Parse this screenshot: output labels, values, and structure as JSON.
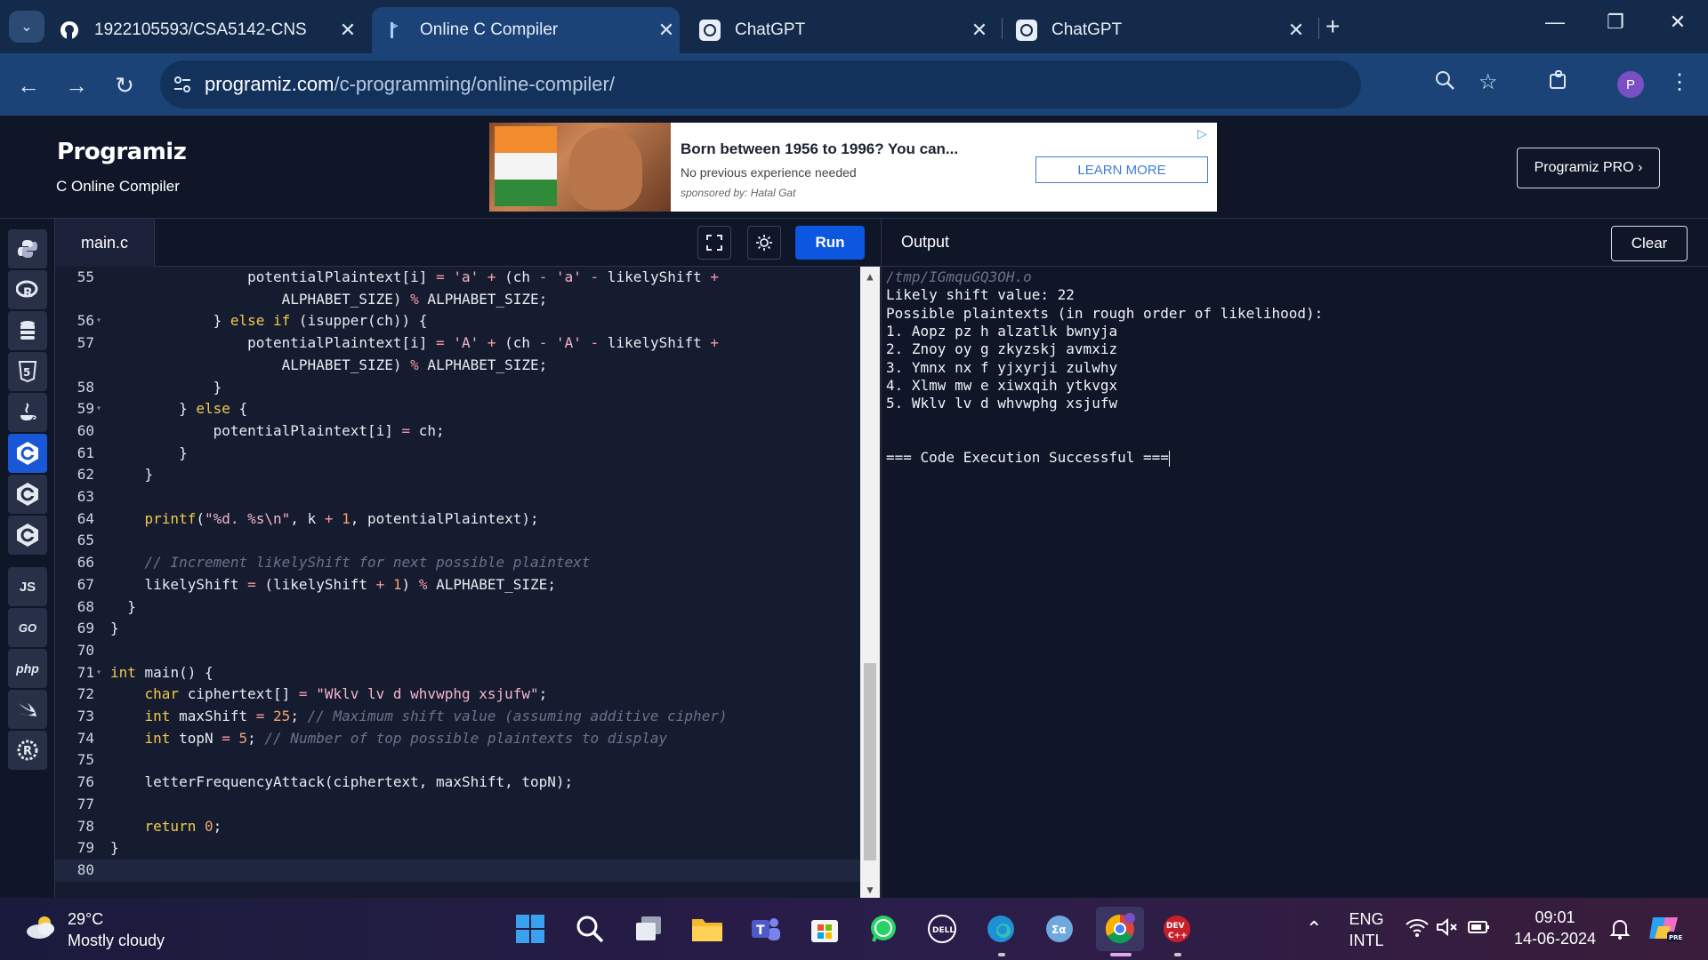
{
  "browser": {
    "tabs": [
      {
        "title": "1922105593/CSA5142-CNS",
        "icon": "github-icon",
        "active": false
      },
      {
        "title": "Online C Compiler",
        "icon": "programiz-icon",
        "active": true
      },
      {
        "title": "ChatGPT",
        "icon": "chatgpt-icon",
        "active": false
      },
      {
        "title": "ChatGPT",
        "icon": "chatgpt-icon",
        "active": false
      }
    ],
    "new_tab": "+",
    "address": {
      "host": "programiz.com",
      "path": "/c-programming/online-compiler/"
    },
    "profile_initial": "P"
  },
  "header": {
    "logo": "Programiz",
    "subtitle": "C Online Compiler",
    "pro_button": "Programiz PRO ›"
  },
  "ad": {
    "title": "Born between 1956 to 1996? You can...",
    "text": "No previous experience needed",
    "sponsor": "sponsored by: Hatal Gat",
    "button": "LEARN MORE"
  },
  "languages": [
    {
      "name": "python-icon",
      "label": "🐍",
      "active": false
    },
    {
      "name": "r-icon",
      "label": "R",
      "active": false
    },
    {
      "name": "sql-icon",
      "label": "≡",
      "active": false
    },
    {
      "name": "html-icon",
      "label": "5",
      "active": false
    },
    {
      "name": "java-icon",
      "label": "♨",
      "active": false
    },
    {
      "name": "c-icon",
      "label": "C",
      "active": true
    },
    {
      "name": "cpp-icon",
      "label": "C",
      "active": false
    },
    {
      "name": "csharp-icon",
      "label": "C",
      "active": false
    },
    {
      "name": "javascript-icon",
      "label": "JS",
      "active": false
    },
    {
      "name": "go-icon",
      "label": "GO",
      "active": false
    },
    {
      "name": "php-icon",
      "label": "php",
      "active": false
    },
    {
      "name": "swift-icon",
      "label": "➶",
      "active": false
    },
    {
      "name": "rust-icon",
      "label": "R",
      "active": false
    }
  ],
  "editor": {
    "file_name": "main.c",
    "run_label": "Run",
    "lines": [
      {
        "n": "55",
        "fold": "",
        "html": "                <span>potentialPlaintext[i]</span> <span class=\"op\">=</span> <span class=\"str\">'a'</span> <span class=\"op\">+</span> (ch <span class=\"op\">-</span> <span class=\"str\">'a'</span> <span class=\"op\">-</span> likelyShift <span class=\"op\">+</span>"
      },
      {
        "n": "",
        "fold": "",
        "html": "                    ALPHABET_SIZE) <span class=\"op\">%</span> ALPHABET_SIZE;"
      },
      {
        "n": "56",
        "fold": "▾",
        "html": "            } <span class=\"kw\">else if</span> (isupper(ch)) {"
      },
      {
        "n": "57",
        "fold": "",
        "html": "                potentialPlaintext[i] <span class=\"op\">=</span> <span class=\"str\">'A'</span> <span class=\"op\">+</span> (ch <span class=\"op\">-</span> <span class=\"str\">'A'</span> <span class=\"op\">-</span> likelyShift <span class=\"op\">+</span>"
      },
      {
        "n": "",
        "fold": "",
        "html": "                    ALPHABET_SIZE) <span class=\"op\">%</span> ALPHABET_SIZE;"
      },
      {
        "n": "58",
        "fold": "",
        "html": "            }"
      },
      {
        "n": "59",
        "fold": "▾",
        "html": "        } <span class=\"kw\">else</span> {"
      },
      {
        "n": "60",
        "fold": "",
        "html": "            potentialPlaintext[i] <span class=\"op\">=</span> ch;"
      },
      {
        "n": "61",
        "fold": "",
        "html": "        }"
      },
      {
        "n": "62",
        "fold": "",
        "html": "    }"
      },
      {
        "n": "63",
        "fold": "",
        "html": ""
      },
      {
        "n": "64",
        "fold": "",
        "html": "    <span class=\"kw\">printf</span>(<span class=\"str\">\"%d. %s\\n\"</span>, k <span class=\"op\">+</span> <span class=\"num\">1</span>, potentialPlaintext);"
      },
      {
        "n": "65",
        "fold": "",
        "html": ""
      },
      {
        "n": "66",
        "fold": "",
        "html": "    <span class=\"cm\">// Increment likelyShift for next possible plaintext</span>"
      },
      {
        "n": "67",
        "fold": "",
        "html": "    likelyShift <span class=\"op\">=</span> (likelyShift <span class=\"op\">+</span> <span class=\"num\">1</span>) <span class=\"op\">%</span> ALPHABET_SIZE;"
      },
      {
        "n": "68",
        "fold": "",
        "html": "  }"
      },
      {
        "n": "69",
        "fold": "",
        "html": "}"
      },
      {
        "n": "70",
        "fold": "",
        "html": ""
      },
      {
        "n": "71",
        "fold": "▾",
        "html": "<span class=\"kw\">int</span> main() {"
      },
      {
        "n": "72",
        "fold": "",
        "html": "    <span class=\"kw\">char</span> ciphertext[] <span class=\"op\">=</span> <span class=\"str\">\"Wklv lv d whvwphg xsjufw\"</span>;"
      },
      {
        "n": "73",
        "fold": "",
        "html": "    <span class=\"kw\">int</span> maxShift <span class=\"op\">=</span> <span class=\"num\">25</span>; <span class=\"cm\">// Maximum shift value (assuming additive cipher)</span>"
      },
      {
        "n": "74",
        "fold": "",
        "html": "    <span class=\"kw\">int</span> topN <span class=\"op\">=</span> <span class=\"num\">5</span>; <span class=\"cm\">// Number of top possible plaintexts to display</span>"
      },
      {
        "n": "75",
        "fold": "",
        "html": ""
      },
      {
        "n": "76",
        "fold": "",
        "html": "    letterFrequencyAttack(ciphertext, maxShift, topN);"
      },
      {
        "n": "77",
        "fold": "",
        "html": ""
      },
      {
        "n": "78",
        "fold": "",
        "html": "    <span class=\"kw\">return</span> <span class=\"num\">0</span>;"
      },
      {
        "n": "79",
        "fold": "",
        "html": "}"
      },
      {
        "n": "80",
        "fold": "",
        "html": ""
      }
    ]
  },
  "output": {
    "title": "Output",
    "clear_label": "Clear",
    "lines": [
      "/tmp/IGmquGQ3OH.o",
      "Likely shift value: 22",
      "Possible plaintexts (in rough order of likelihood):",
      "1. Aopz pz h alzatlk bwnyja",
      "2. Znoy oy g zkyzskj avmxiz",
      "3. Ymnx nx f yjxyrji zulwhy",
      "4. Xlmw mw e xiwxqih ytkvgx",
      "5. Wklv lv d whvwphg xsjufw",
      "",
      "",
      "=== Code Execution Successful ==="
    ]
  },
  "taskbar": {
    "temperature": "29°C",
    "weather": "Mostly cloudy",
    "language_top": "ENG",
    "language_bottom": "INTL",
    "time": "09:01",
    "date": "14-06-2024",
    "apps": [
      "start-icon",
      "search-icon",
      "task-view-icon",
      "file-explorer-icon",
      "teams-icon",
      "store-icon",
      "whatsapp-icon",
      "dell-icon",
      "edge-icon",
      "app-icon",
      "chrome-icon",
      "devcpp-icon"
    ]
  },
  "colors": {
    "accent": "#0d57e0",
    "background": "#0f1628",
    "editor_bg": "#161c30"
  }
}
